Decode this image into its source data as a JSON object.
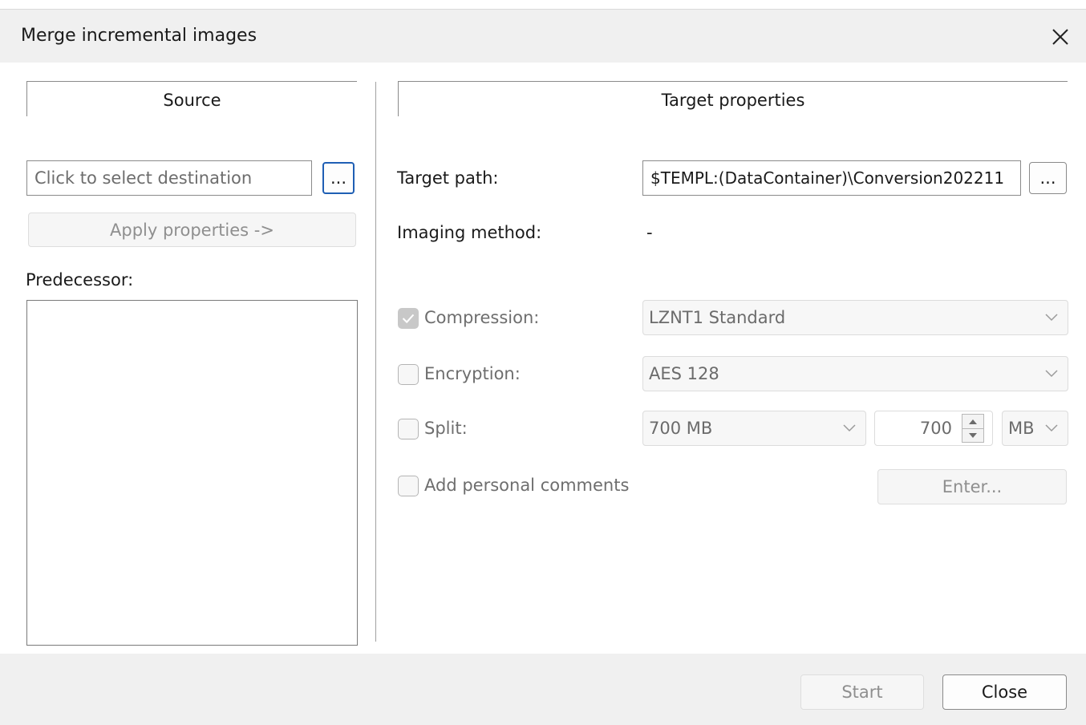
{
  "window": {
    "title": "Merge incremental images"
  },
  "source": {
    "header": "Source",
    "destination_placeholder": "Click to select destination",
    "browse_label": "...",
    "apply_label": "Apply properties ->",
    "predecessor_label": "Predecessor:"
  },
  "target": {
    "header": "Target properties",
    "path_label": "Target path:",
    "path_value": "$TEMPL:(DataContainer)\\Conversion202211",
    "browse_label": "...",
    "imaging_label": "Imaging method:",
    "imaging_value": "-",
    "compression": {
      "label": "Compression:",
      "checked": true,
      "value": "LZNT1 Standard"
    },
    "encryption": {
      "label": "Encryption:",
      "checked": false,
      "value": "AES 128"
    },
    "split": {
      "label": "Split:",
      "checked": false,
      "value": "700 MB",
      "amount": "700",
      "unit": "MB"
    },
    "comments": {
      "label": "Add personal comments",
      "checked": false,
      "enter_label": "Enter..."
    }
  },
  "footer": {
    "start_label": "Start",
    "close_label": "Close"
  },
  "colors": {
    "focus": "#1f5fb4",
    "background": "#f0f0f0",
    "panel": "#ffffff"
  }
}
